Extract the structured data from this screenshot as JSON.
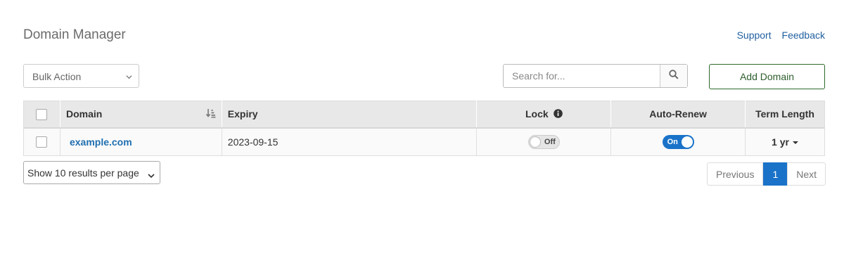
{
  "header": {
    "title": "Domain Manager",
    "links": {
      "support": "Support",
      "feedback": "Feedback"
    }
  },
  "toolbar": {
    "bulk_action": "Bulk Action",
    "search_placeholder": "Search for...",
    "add_domain": "Add Domain"
  },
  "table": {
    "columns": {
      "domain": "Domain",
      "expiry": "Expiry",
      "lock": "Lock",
      "auto_renew": "Auto-Renew",
      "term_length": "Term Length"
    },
    "rows": [
      {
        "domain": "example.com",
        "expiry": "2023-09-15",
        "lock": "Off",
        "auto_renew": "On",
        "term": "1 yr"
      }
    ]
  },
  "footer": {
    "per_page": "Show 10 results per page",
    "pager": {
      "previous": "Previous",
      "current": "1",
      "next": "Next"
    }
  },
  "colors": {
    "accent": "#1a73c9",
    "add_button": "#2d6a2d",
    "link": "#1f6fb0"
  },
  "icons": {
    "bulk_chevron": "chevron-down-icon",
    "search": "search-icon",
    "sort": "sort-icon",
    "info": "info-icon",
    "caret": "caret-down-icon"
  }
}
